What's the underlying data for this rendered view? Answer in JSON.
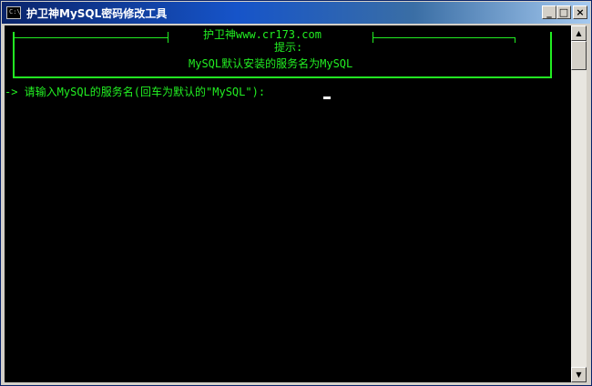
{
  "window": {
    "title": "护卫神MySQL密码修改工具",
    "icon_label": "C:\\",
    "buttons": {
      "minimize": "_",
      "maximize": "□",
      "close": "×"
    }
  },
  "console": {
    "banner_line1": "护卫神www.cr173.com",
    "banner_line2": "提示:",
    "banner_line3": "MySQL默认安装的服务名为MySQL",
    "prompt": "-> 请输入MySQL的服务名(回车为默认的\"MySQL\"):",
    "text_color": "#22ee22",
    "background_color": "#000000"
  },
  "scrollbar": {
    "up_arrow": "▲",
    "down_arrow": "▼"
  }
}
